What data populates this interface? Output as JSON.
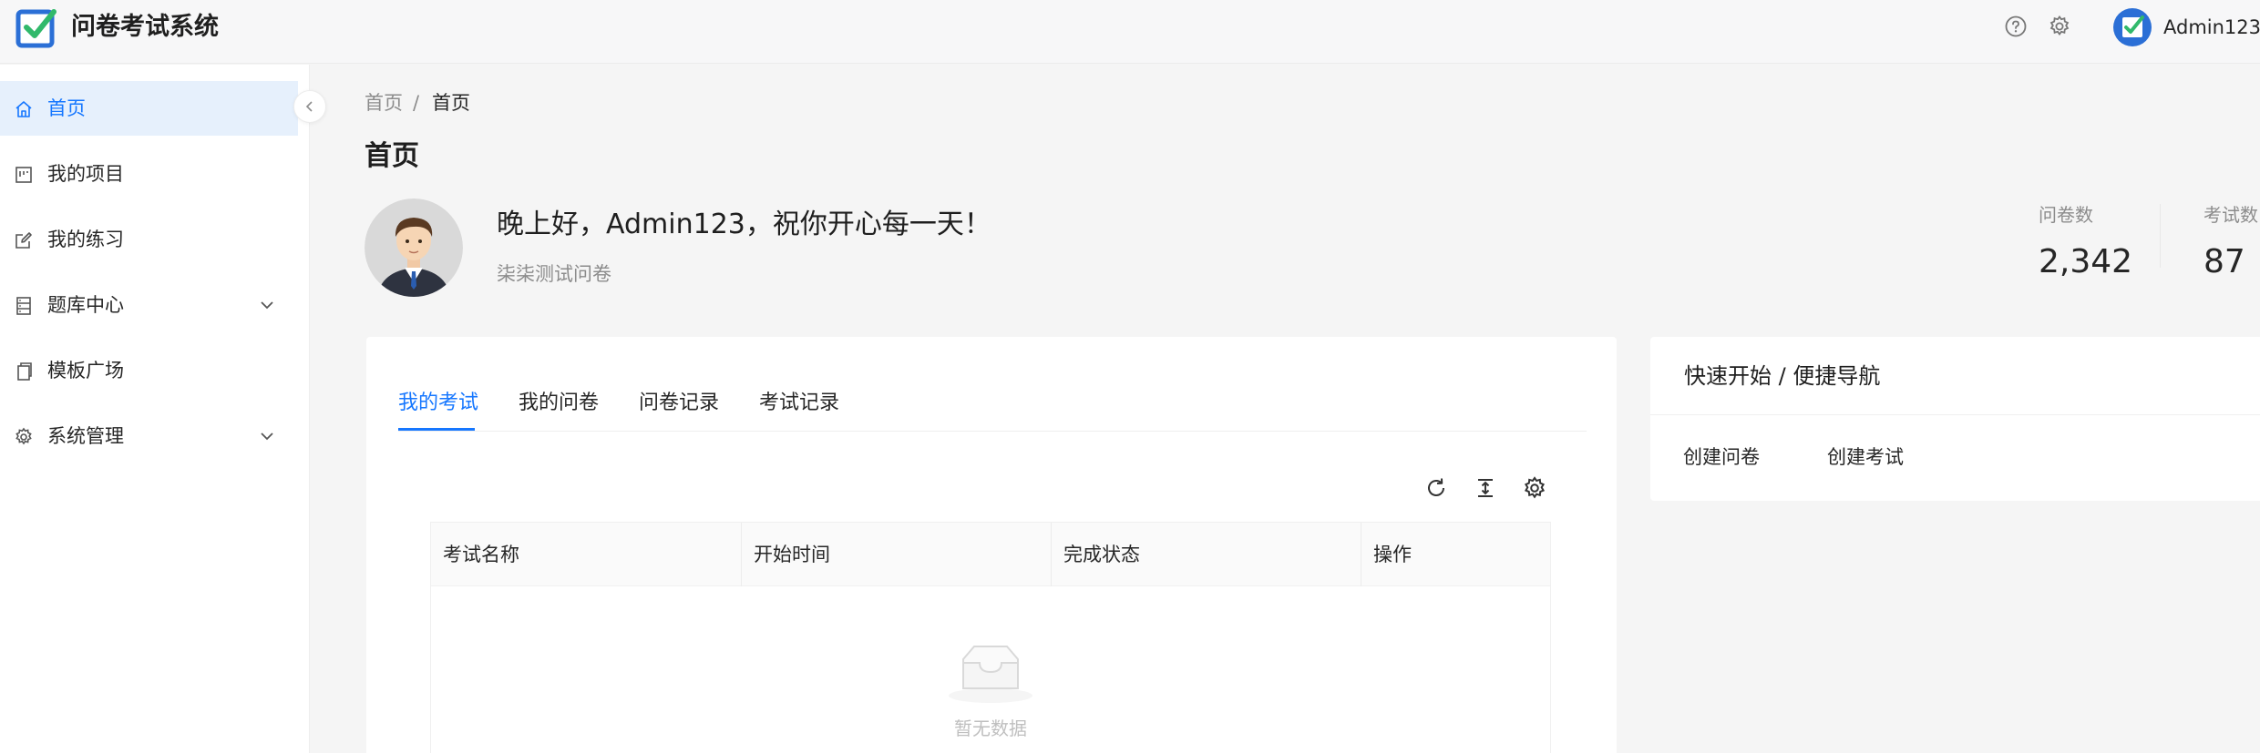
{
  "app": {
    "title": "问卷考试系统"
  },
  "header": {
    "user_name": "Admin123"
  },
  "sidebar": {
    "items": [
      {
        "label": "首页",
        "icon": "home-icon",
        "active": true
      },
      {
        "label": "我的项目",
        "icon": "project-icon"
      },
      {
        "label": "我的练习",
        "icon": "edit-icon"
      },
      {
        "label": "题库中心",
        "icon": "database-icon",
        "has_submenu": true
      },
      {
        "label": "模板广场",
        "icon": "template-icon"
      },
      {
        "label": "系统管理",
        "icon": "gear-icon",
        "has_submenu": true
      }
    ]
  },
  "breadcrumb": {
    "root": "首页",
    "separator": "/",
    "current": "首页"
  },
  "page": {
    "title": "首页"
  },
  "welcome": {
    "greeting": "晚上好，Admin123，祝你开心每一天！",
    "subtitle": "柒柒测试问卷"
  },
  "stats": [
    {
      "label": "问卷数",
      "value": "2,342"
    },
    {
      "label": "考试数",
      "value": "87"
    }
  ],
  "tabs": [
    {
      "label": "我的考试",
      "active": true
    },
    {
      "label": "我的问卷"
    },
    {
      "label": "问卷记录"
    },
    {
      "label": "考试记录"
    }
  ],
  "table": {
    "columns": [
      "考试名称",
      "开始时间",
      "完成状态",
      "操作"
    ],
    "empty_text": "暂无数据"
  },
  "quick_nav": {
    "title": "快速开始 / 便捷导航",
    "links": [
      "创建问卷",
      "创建考试"
    ]
  },
  "colors": {
    "primary": "#1677ff",
    "active_bg": "#e6f0fc",
    "logo_green": "#31b96b"
  }
}
